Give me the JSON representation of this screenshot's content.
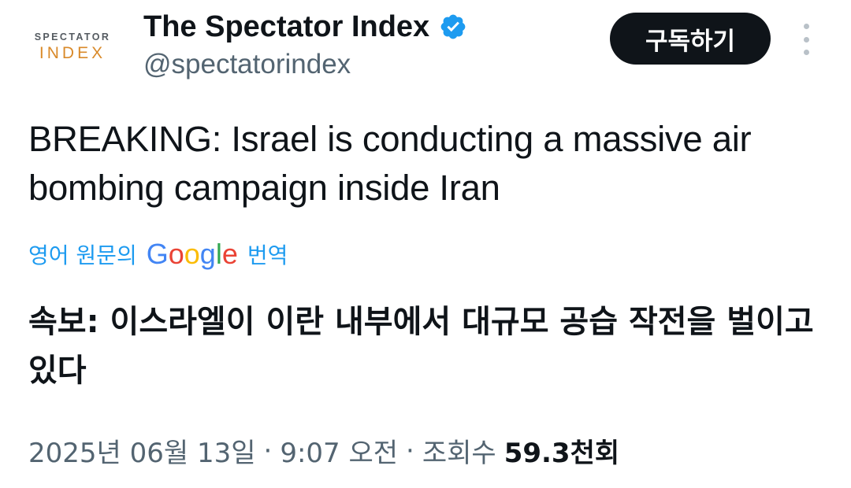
{
  "avatar": {
    "line1": "SPECTATOR",
    "line2": "INDEX"
  },
  "account": {
    "display_name": "The Spectator Index",
    "handle": "@spectatorindex",
    "verified_color": "#1d9bf0"
  },
  "subscribe_label": "구독하기",
  "tweet": {
    "text": "BREAKING: Israel is conducting a massive air bombing campaign inside Iran"
  },
  "translation": {
    "prefix": "영어 원문의",
    "provider": "Google",
    "suffix": "번역",
    "text": "속보: 이스라엘이 이란 내부에서 대규모 공습 작전을 벌이고 있다"
  },
  "meta": {
    "date": "2025년 06월 13일",
    "time": "9:07 오전",
    "views_label": "조회수",
    "views_count": "59.3천회",
    "separator": "·"
  },
  "colors": {
    "text": "#0f1419",
    "secondary": "#536471",
    "accent": "#1d9bf0",
    "button_bg": "#0f1419",
    "avatar_orange": "#d98a2a"
  },
  "icons": {
    "verified": "verified-badge-icon",
    "more": "more-vertical-icon"
  }
}
